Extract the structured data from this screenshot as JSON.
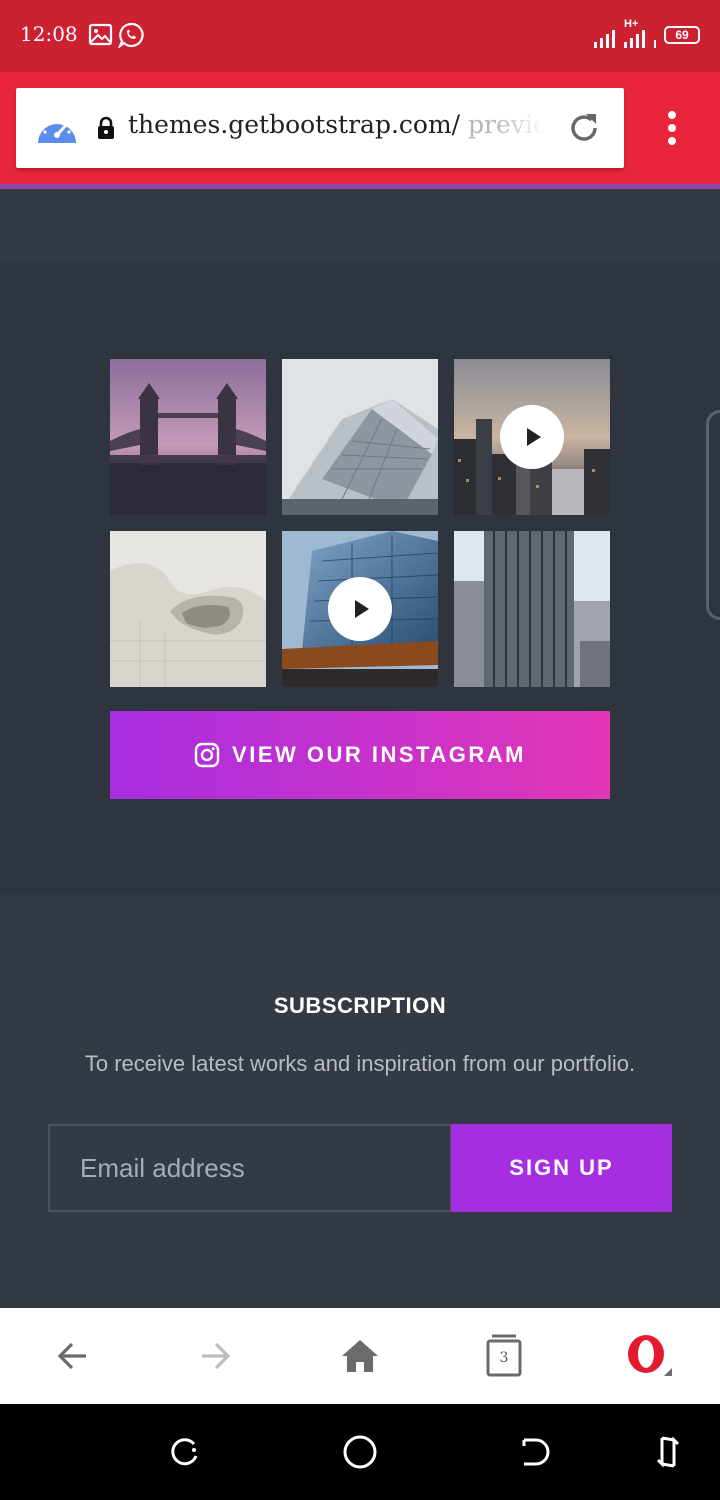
{
  "status_bar": {
    "time": "12:08",
    "network_type": "H+",
    "battery": "69",
    "icons": [
      "image-icon",
      "whatsapp-icon",
      "signal-icon",
      "signal-icon",
      "battery-icon"
    ]
  },
  "browser": {
    "url_host": "themes.getbootstrap.com/",
    "url_path": " preview",
    "colors": {
      "status_bar": "#cc2131",
      "toolbar": "#e8253a",
      "accent_line": "#8e44ad"
    }
  },
  "instagram": {
    "tiles": [
      {
        "name": "tower-bridge",
        "has_play": false
      },
      {
        "name": "glass-building",
        "has_play": false
      },
      {
        "name": "city-skyline",
        "has_play": true
      },
      {
        "name": "white-architecture",
        "has_play": false
      },
      {
        "name": "blue-glass-tower",
        "has_play": true
      },
      {
        "name": "skyscrapers",
        "has_play": false
      }
    ],
    "button_label": "VIEW OUR INSTAGRAM",
    "button_colors": [
      "#a72ee0",
      "#e236b7"
    ]
  },
  "subscription": {
    "title": "SUBSCRIPTION",
    "description": "To receive latest works and inspiration from our portfolio.",
    "email_placeholder": "Email address",
    "signup_label": "SIGN UP"
  },
  "browser_nav": {
    "tab_count": "3",
    "buttons": [
      "back-icon",
      "forward-icon",
      "home-icon",
      "tabs-icon",
      "opera-menu-icon"
    ]
  },
  "system_nav": {
    "buttons": [
      "recents-icon",
      "home-icon",
      "back-icon",
      "rotate-icon"
    ]
  }
}
